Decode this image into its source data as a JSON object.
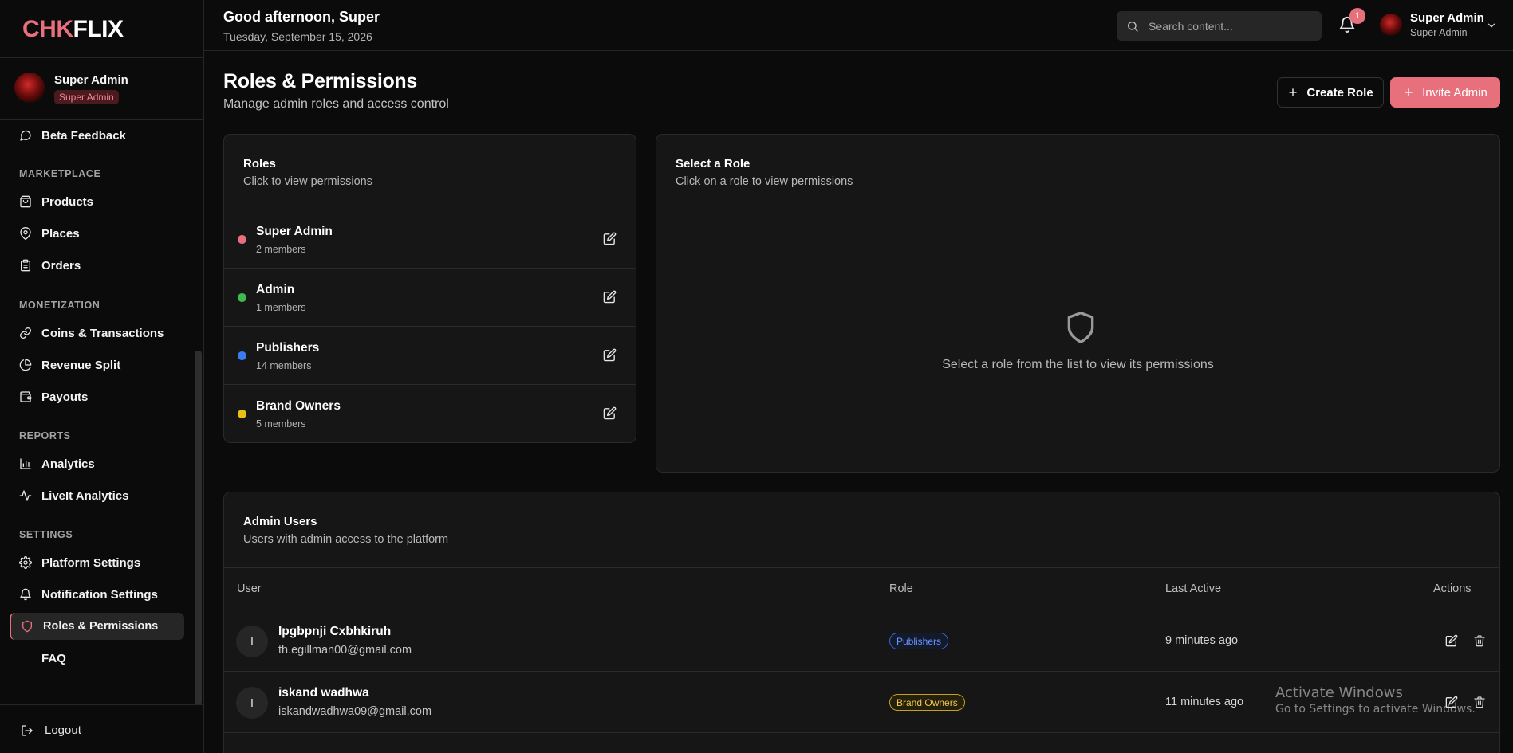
{
  "brand": {
    "logo_part1": "CHK",
    "logo_part2": "FLIX"
  },
  "sidebar": {
    "profile": {
      "name": "Super Admin",
      "badge": "Super Admin"
    },
    "items": [
      {
        "label": "Beta Feedback",
        "icon": "message-circle-icon"
      },
      {
        "label": "Products",
        "icon": "shopping-bag-icon"
      },
      {
        "label": "Places",
        "icon": "map-pin-icon"
      },
      {
        "label": "Orders",
        "icon": "clipboard-icon"
      },
      {
        "label": "Coins & Transactions",
        "icon": "link-icon"
      },
      {
        "label": "Revenue Split",
        "icon": "pie-chart-icon"
      },
      {
        "label": "Payouts",
        "icon": "wallet-icon"
      },
      {
        "label": "Analytics",
        "icon": "bar-chart-icon"
      },
      {
        "label": "LiveIt Analytics",
        "icon": "activity-icon"
      },
      {
        "label": "Platform Settings",
        "icon": "gear-icon"
      },
      {
        "label": "Notification Settings",
        "icon": "bell-icon"
      },
      {
        "label": "Roles & Permissions",
        "icon": "shield-icon",
        "active": true
      },
      {
        "label": "FAQ",
        "icon": ""
      }
    ],
    "sections": [
      "MARKETPLACE",
      "MONETIZATION",
      "REPORTS",
      "SETTINGS"
    ],
    "logout_label": "Logout"
  },
  "header": {
    "greeting": "Good afternoon, Super",
    "date": "Tuesday, September 15, 2026",
    "search_placeholder": "Search content...",
    "notification_count": "1",
    "user_name": "Super Admin",
    "user_role": "Super Admin"
  },
  "page": {
    "title": "Roles & Permissions",
    "subtitle": "Manage admin roles and access control",
    "create_role_label": "Create Role",
    "invite_admin_label": "Invite Admin"
  },
  "roles_card": {
    "title": "Roles",
    "subtitle": "Click to view permissions",
    "roles": [
      {
        "name": "Super Admin",
        "members": "2 members",
        "color": "#e8707c"
      },
      {
        "name": "Admin",
        "members": "1 members",
        "color": "#3fb950"
      },
      {
        "name": "Publishers",
        "members": "14 members",
        "color": "#3b7bf0"
      },
      {
        "name": "Brand Owners",
        "members": "5 members",
        "color": "#e6c215"
      }
    ]
  },
  "select_card": {
    "title": "Select a Role",
    "subtitle": "Click on a role to view permissions",
    "empty_text": "Select a role from the list to view its permissions"
  },
  "admins_card": {
    "title": "Admin Users",
    "subtitle": "Users with admin access to the platform",
    "columns": [
      "User",
      "Role",
      "Last Active",
      "Actions"
    ],
    "rows": [
      {
        "initial": "I",
        "name": "Ipgbpnji Cxbhkiruh",
        "email": "th.egillman00@gmail.com",
        "role": "Publishers",
        "last_active": "9 minutes ago"
      },
      {
        "initial": "I",
        "name": "iskand wadhwa",
        "email": "iskandwadhwa09@gmail.com",
        "role": "Brand Owners",
        "last_active": "11 minutes ago"
      }
    ]
  },
  "watermark": {
    "line1": "Activate Windows",
    "line2": "Go to Settings to activate Windows."
  },
  "colors": {
    "accent": "#e8707c",
    "background": "#0b0b0b",
    "card": "#161616"
  }
}
